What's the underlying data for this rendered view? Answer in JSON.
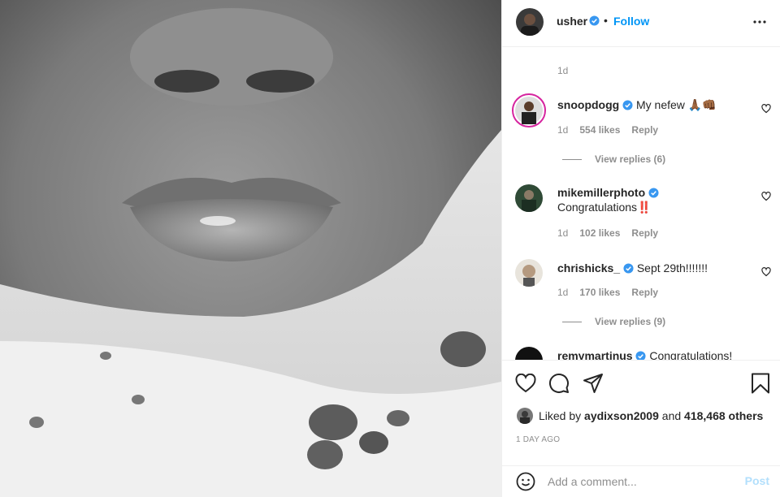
{
  "header": {
    "username": "usher",
    "dot": "•",
    "follow_label": "Follow",
    "more_icon": "more-horizontal-icon"
  },
  "comments": [
    {
      "meta_time": "1d"
    },
    {
      "username": "snoopdogg",
      "text": "My nefew 🙏🏾👊🏾",
      "time": "1d",
      "likes": "554 likes",
      "reply": "Reply",
      "view_replies": "View replies (6)"
    },
    {
      "username": "mikemillerphoto",
      "text": "Congratulations‼️",
      "time": "1d",
      "likes": "102 likes",
      "reply": "Reply"
    },
    {
      "username": "chrishicks_",
      "text": "Sept 29th!!!!!!!",
      "time": "1d",
      "likes": "170 likes",
      "reply": "Reply",
      "view_replies": "View replies (9)"
    },
    {
      "username": "remymartinus",
      "text": "Congratulations!"
    }
  ],
  "likes": {
    "prefix": "Liked by",
    "user": "aydixson2009",
    "conj": "and",
    "others": "418,468 others"
  },
  "date": "1 DAY AGO",
  "add_comment": {
    "placeholder": "Add a comment...",
    "post_label": "Post"
  },
  "colors": {
    "link_blue": "#0095f6",
    "verified_blue": "#3897f0",
    "muted": "#8e8e8e"
  }
}
